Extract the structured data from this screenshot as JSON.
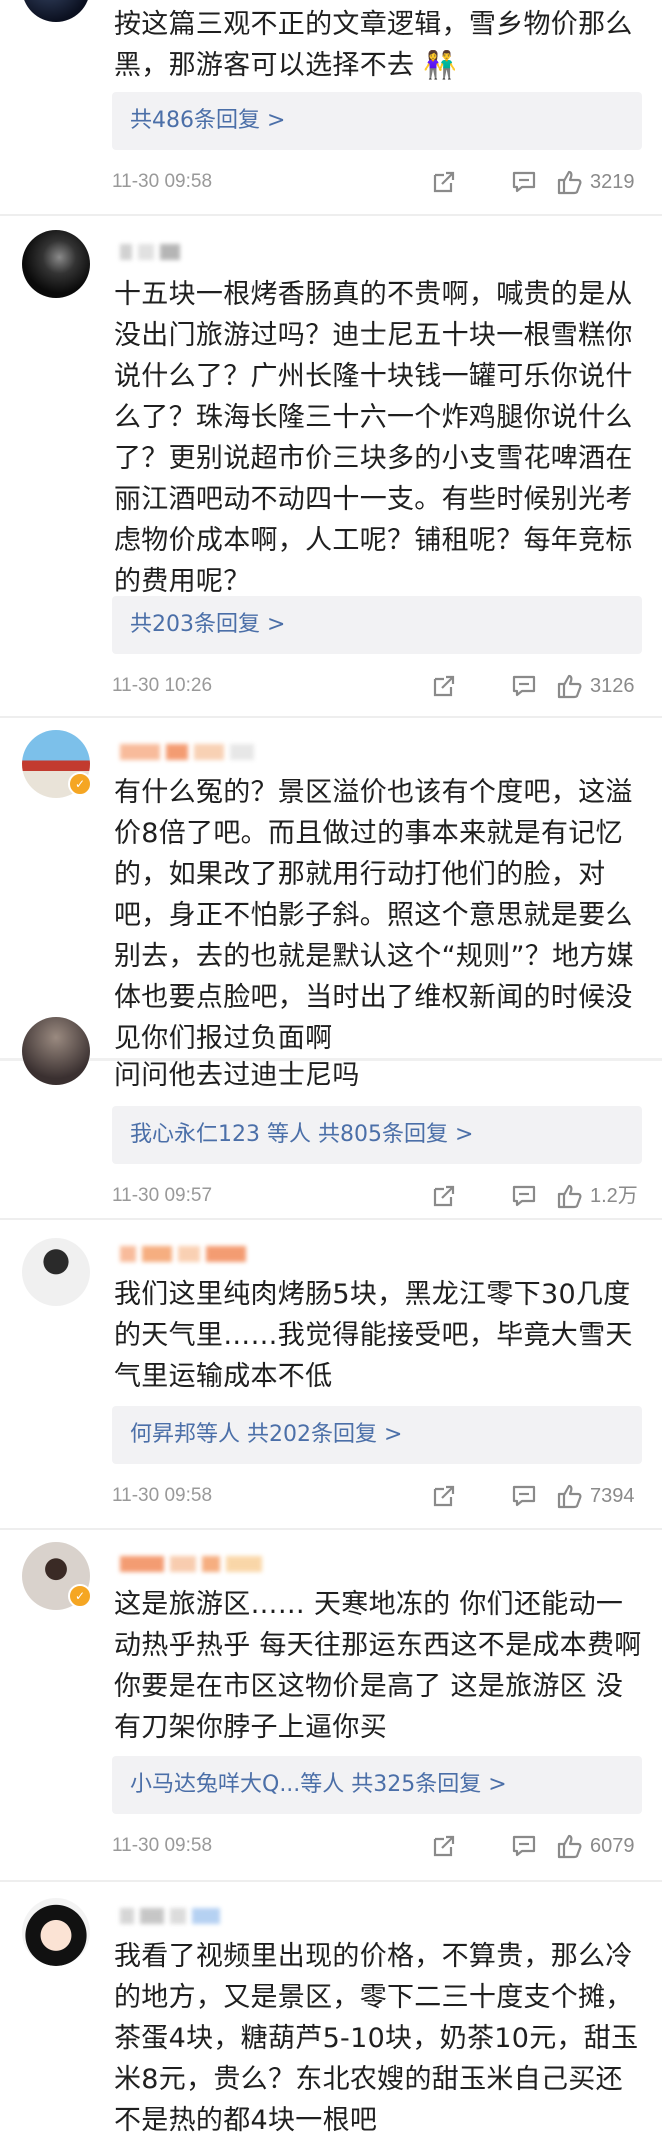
{
  "comments": [
    {
      "text": "按这篇三观不正的文章逻辑，雪乡物价那么黑，那游客可以选择不去 👫",
      "replies": "共486条回复 >",
      "time": "11-30 09:58",
      "likes": "3219"
    },
    {
      "text": "十五块一根烤香肠真的不贵啊，喊贵的是从没出门旅游过吗？迪士尼五十块一根雪糕你说什么了？广州长隆十块钱一罐可乐你说什么了？珠海长隆三十六一个炸鸡腿你说什么了？更别说超市价三块多的小支雪花啤酒在丽江酒吧动不动四十一支。有些时候别光考虑物价成本啊，人工呢？铺租呢？每年竞标的费用呢？",
      "replies": "共203条回复 >",
      "time": "11-30 10:26",
      "likes": "3126"
    },
    {
      "text": "有什么冤的？景区溢价也该有个度吧，这溢价8倍了吧。而且做过的事本来就是有记忆的，如果改了那就用行动打他们的脸，对吧，身正不怕影子斜。照这个意思就是要么别去，去的也就是默认这个“规则”？地方媒体也要点脸吧，当时出了维权新闻的时候没见你们报过负面啊"
    },
    {
      "text": "问问他去过迪士尼吗",
      "replies": "我心永仁123 等人  共805条回复 >",
      "time": "11-30 09:57",
      "likes": "1.2万"
    },
    {
      "text": "我们这里纯肉烤肠5块，黑龙江零下30几度的天气里……我觉得能接受吧，毕竟大雪天气里运输成本不低",
      "replies": "何昇邦等人  共202条回复 >",
      "time": "11-30 09:58",
      "likes": "7394"
    },
    {
      "text": "这是旅游区…… 天寒地冻的 你们还能动一动热乎热乎 每天往那运东西这不是成本费啊 你要是在市区这物价是高了 这是旅游区 没有刀架你脖子上逼你买",
      "replies": "小马达兔咩大Q...等人  共325条回复 >",
      "time": "11-30 09:58",
      "likes": "6079"
    },
    {
      "text": "我看了视频里出现的价格，不算贵，那么冷的地方，又是景区，零下二三十度支个摊，茶蛋4块，糖葫芦5-10块，奶茶10元，甜玉米8元，贵么？东北农嫂的甜玉米自己买还不是热的都4块一根吧"
    }
  ],
  "colors": {
    "link": "#4b6fa8",
    "meta": "#999999",
    "reply_bg": "#f2f2f4",
    "badge": "#f5a623"
  }
}
